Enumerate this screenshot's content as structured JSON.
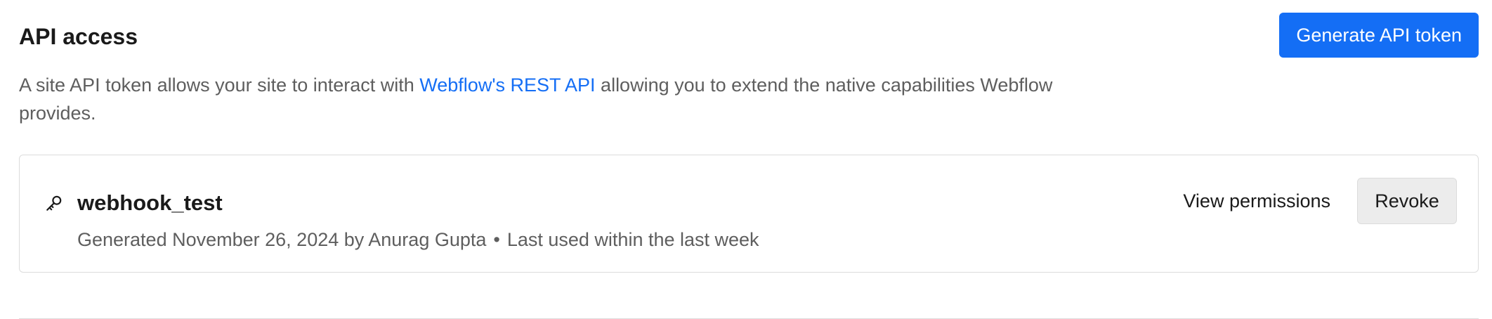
{
  "section": {
    "title": "API access",
    "generate_button_label": "Generate API token",
    "description_before_link": "A site API token allows your site to interact with ",
    "description_link": "Webflow's REST API",
    "description_after_link": " allowing you to extend the native capabilities Webflow provides."
  },
  "tokens": [
    {
      "icon": "key-icon",
      "name": "webhook_test",
      "generated": "Generated November 26, 2024 by Anurag Gupta",
      "separator": "•",
      "last_used": "Last used within the last week",
      "view_permissions_label": "View permissions",
      "revoke_label": "Revoke"
    }
  ],
  "colors": {
    "accent": "#146ef5",
    "muted_text": "#5e5e5e",
    "border": "#dcdcdc",
    "secondary_button_bg": "#ececec"
  }
}
